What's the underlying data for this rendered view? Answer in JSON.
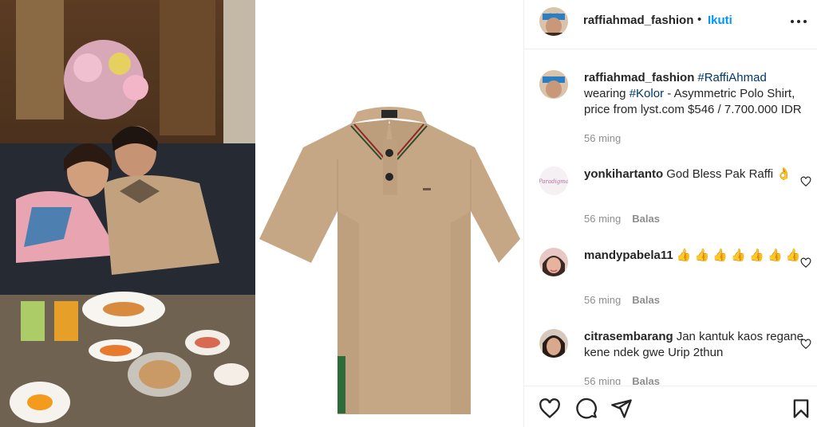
{
  "post": {
    "username": "raffiahmad_fashion",
    "dot": "•",
    "follow_label": "Ikuti",
    "caption": {
      "tag1": "#RaffiAhmad",
      "text1": "wearing",
      "tag2": "#Kolor",
      "text2": "- Asymmetric Polo Shirt, price from lyst.com $546 / 7.700.000 IDR",
      "time": "56 ming"
    }
  },
  "comments": [
    {
      "username": "yonkihartanto",
      "text": "God Bless Pak Raffi 👌",
      "time": "56 ming",
      "reply_label": "Balas"
    },
    {
      "username": "mandypabela11",
      "text": "👍 👍 👍 👍 👍 👍 👍",
      "time": "56 ming",
      "reply_label": "Balas"
    },
    {
      "username": "citrasembarang",
      "text": "Jan kantuk kaos regane kene ndek gwe Urip 2thun",
      "time": "56 ming",
      "reply_label": "Balas"
    }
  ],
  "colors": {
    "link_blue": "#0095f6",
    "hashtag": "#00376b",
    "muted": "#8e8e8e",
    "shirt": "#c6a785",
    "stripe_green": "#2e6b3a"
  },
  "icons": [
    "more-icon",
    "heart-icon",
    "comment-icon",
    "share-icon",
    "bookmark-icon"
  ]
}
